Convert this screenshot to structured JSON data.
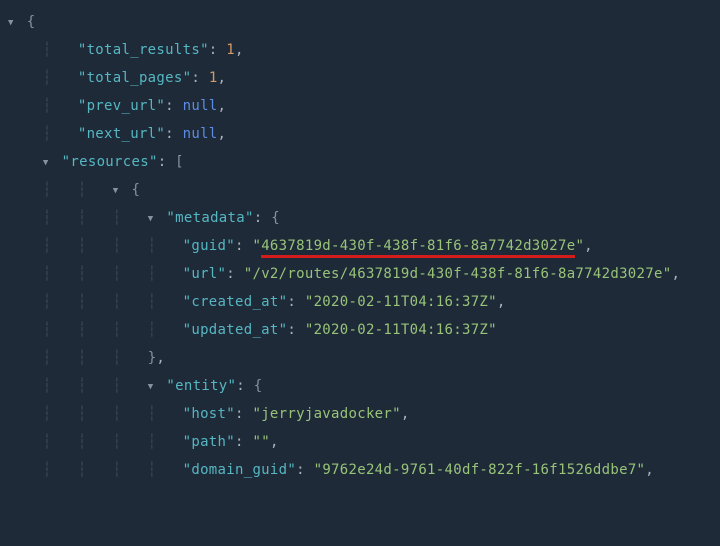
{
  "json_tree": {
    "root": {
      "total_results": {
        "key": "total_results",
        "value": "1",
        "type": "number"
      },
      "total_pages": {
        "key": "total_pages",
        "value": "1",
        "type": "number"
      },
      "prev_url": {
        "key": "prev_url",
        "value": "null",
        "type": "null"
      },
      "next_url": {
        "key": "next_url",
        "value": "null",
        "type": "null"
      },
      "resources_key": "resources",
      "resources": [
        {
          "metadata_key": "metadata",
          "metadata": {
            "guid": {
              "key": "guid",
              "value": "4637819d-430f-438f-81f6-8a7742d3027e",
              "highlighted": true
            },
            "url": {
              "key": "url",
              "value": "/v2/routes/4637819d-430f-438f-81f6-8a7742d3027e"
            },
            "created_at": {
              "key": "created_at",
              "value": "2020-02-11T04:16:37Z"
            },
            "updated_at": {
              "key": "updated_at",
              "value": "2020-02-11T04:16:37Z"
            }
          },
          "entity_key": "entity",
          "entity": {
            "host": {
              "key": "host",
              "value": "jerryjavadocker"
            },
            "path": {
              "key": "path",
              "value": ""
            },
            "domain_guid": {
              "key": "domain_guid",
              "value": "9762e24d-9761-40df-822f-16f1526ddbe7"
            }
          }
        }
      ]
    }
  },
  "glyphs": {
    "toggle_expanded": "▼",
    "guide": "┆"
  }
}
